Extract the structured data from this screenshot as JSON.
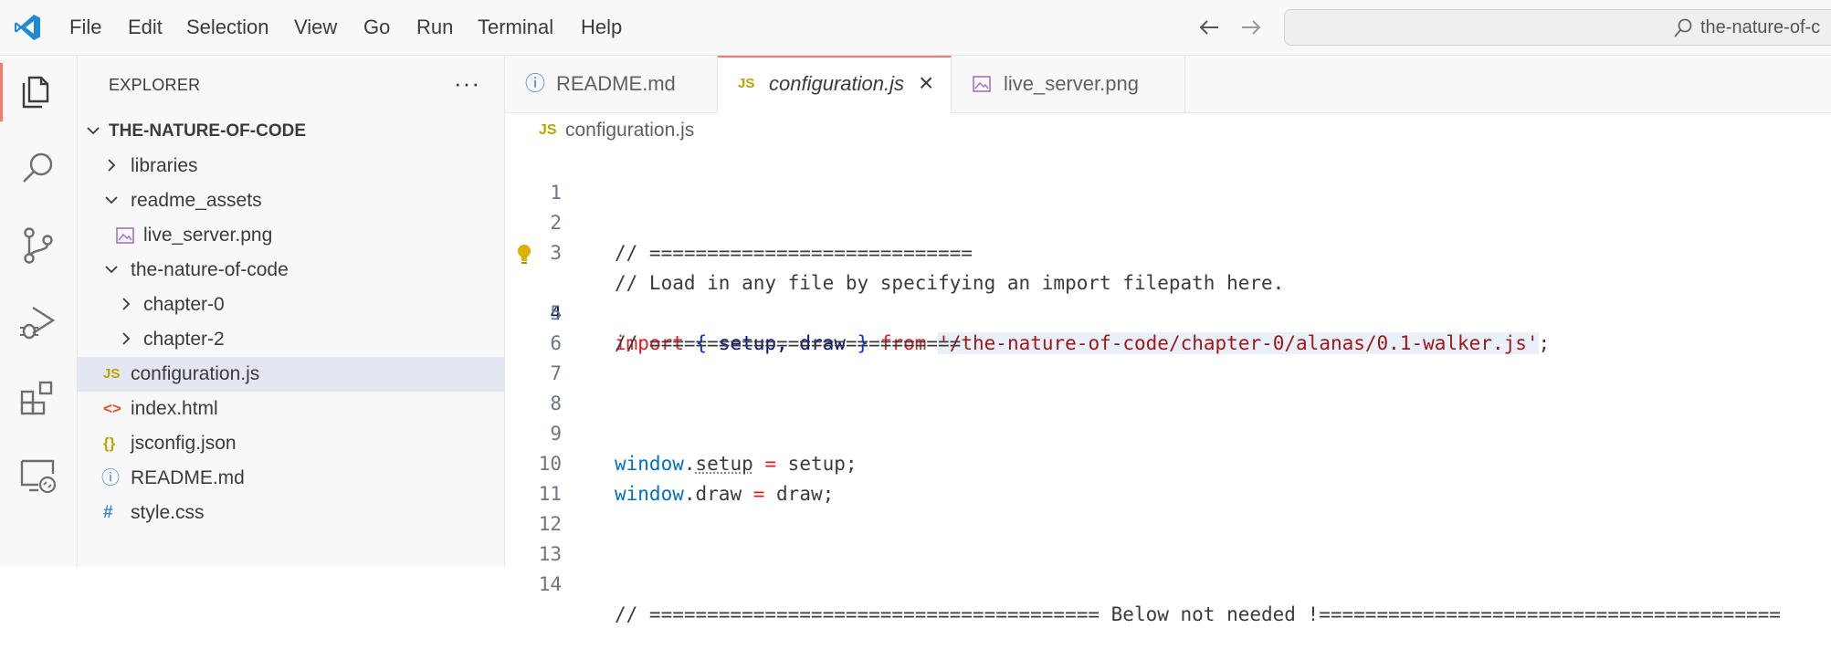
{
  "menu": [
    "File",
    "Edit",
    "Selection",
    "View",
    "Go",
    "Run",
    "Terminal",
    "Help"
  ],
  "command_center": {
    "text": "the-nature-of-c"
  },
  "activity_bar": [
    "explorer-icon",
    "search-icon",
    "source-control-icon",
    "run-debug-icon",
    "extensions-icon",
    "remote-explorer-icon"
  ],
  "explorer": {
    "title": "EXPLORER",
    "more": "···",
    "root": "THE-NATURE-OF-CODE",
    "items": [
      {
        "label": "libraries",
        "type": "folder"
      },
      {
        "label": "readme_assets",
        "type": "folder"
      },
      {
        "label": "live_server.png",
        "type": "image"
      },
      {
        "label": "the-nature-of-code",
        "type": "folder"
      },
      {
        "label": "chapter-0",
        "type": "folder"
      },
      {
        "label": "chapter-2",
        "type": "folder"
      },
      {
        "label": "configuration.js",
        "type": "js",
        "icon": "JS"
      },
      {
        "label": "index.html",
        "type": "html",
        "icon": "<>"
      },
      {
        "label": "jsconfig.json",
        "type": "json",
        "icon": "{}"
      },
      {
        "label": "README.md",
        "type": "info",
        "icon": "ⓘ"
      },
      {
        "label": "style.css",
        "type": "css",
        "icon": "#"
      }
    ]
  },
  "tabs": [
    {
      "label": "README.md",
      "icon": "ⓘ"
    },
    {
      "label": "configuration.js",
      "icon": "JS",
      "close": "×"
    },
    {
      "label": "live_server.png"
    }
  ],
  "breadcrumb": {
    "icon": "JS",
    "file": "configuration.js"
  },
  "editor": {
    "line_numbers": [
      "1",
      "2",
      "3",
      "4",
      "5",
      "6",
      "7",
      "8",
      "9",
      "10",
      "11",
      "12",
      "13",
      "14"
    ],
    "lines": [
      "",
      "// ============================",
      "// Load in any file by specifying an import filepath here.",
      "",
      "// ===========================",
      "",
      "",
      "",
      "",
      "",
      "",
      "",
      "",
      "// ======================================= Below not needed !========================================"
    ],
    "line4": {
      "kw_import": "import",
      "brace_open": "{",
      "names": " setup, draw ",
      "brace_close": "}",
      "kw_from": "from",
      "path": "'/the-nature-of-code/chapter-0/alanas/0.1-walker.js'",
      "end": ";"
    },
    "line9": {
      "obj": "window",
      "dot": ".",
      "prop": "setup",
      "eq": " = ",
      "val": "setup;"
    },
    "line10": {
      "obj": "window",
      "dot": ".",
      "prop": "draw",
      "eq": " = ",
      "val": "draw;"
    }
  }
}
